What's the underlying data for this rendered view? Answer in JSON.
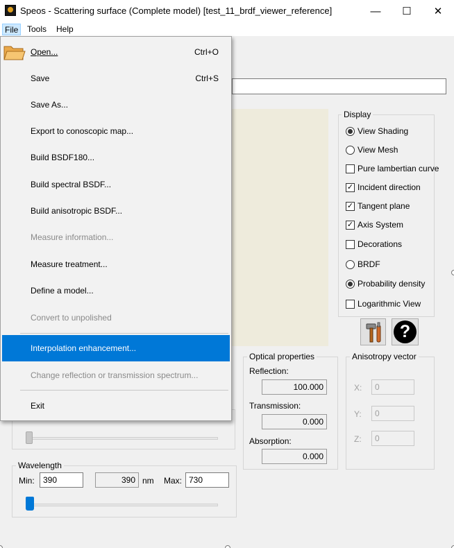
{
  "window": {
    "title": "Speos - Scattering surface (Complete model) [test_11_brdf_viewer_reference]",
    "minimize": "—",
    "maximize": "☐",
    "close": "✕"
  },
  "menubar": {
    "file": "File",
    "tools": "Tools",
    "help": "Help"
  },
  "file_menu": {
    "items": [
      {
        "label": "Open...",
        "shortcut": "Ctrl+O",
        "enabled": true
      },
      {
        "label": "Save",
        "shortcut": "Ctrl+S",
        "enabled": true
      },
      {
        "label": "Save As...",
        "shortcut": "",
        "enabled": true
      },
      {
        "label": "Export to conoscopic map...",
        "shortcut": "",
        "enabled": true
      },
      {
        "label": "Build BSDF180...",
        "shortcut": "",
        "enabled": true
      },
      {
        "label": "Build spectral BSDF...",
        "shortcut": "",
        "enabled": true
      },
      {
        "label": "Build anisotropic BSDF...",
        "shortcut": "",
        "enabled": true
      },
      {
        "label": "Measure information...",
        "shortcut": "",
        "enabled": false
      },
      {
        "label": "Measure treatment...",
        "shortcut": "",
        "enabled": true
      },
      {
        "label": "Define a model...",
        "shortcut": "",
        "enabled": true
      },
      {
        "label": "Convert to unpolished",
        "shortcut": "",
        "enabled": false
      },
      {
        "label": "Interpolation enhancement...",
        "shortcut": "",
        "enabled": true,
        "highlighted": true
      },
      {
        "label": "Change reflection or transmission spectrum...",
        "shortcut": "",
        "enabled": false
      },
      {
        "label": "Exit",
        "shortcut": "",
        "enabled": true
      }
    ]
  },
  "display": {
    "title": "Display",
    "view_shading": "View Shading",
    "view_mesh": "View Mesh",
    "pure_lambertian": "Pure lambertian curve",
    "incident_direction": "Incident direction",
    "tangent_plane": "Tangent plane",
    "axis_system": "Axis System",
    "decorations": "Decorations",
    "brdf": "BRDF",
    "probability_density": "Probability density",
    "logarithmic_view": "Logarithmic View"
  },
  "optical": {
    "title": "Optical properties",
    "reflection_label": "Reflection:",
    "reflection": "100.000",
    "transmission_label": "Transmission:",
    "transmission": "0.000",
    "absorption_label": "Absorption:",
    "absorption": "0.000"
  },
  "anisotropy": {
    "title": "Anisotropy vector",
    "x_label": "X:",
    "x": "0",
    "y_label": "Y:",
    "y": "0",
    "z_label": "Z:",
    "z": "0"
  },
  "wavelength": {
    "title": "Wavelength",
    "min_label": "Min:",
    "min": "390",
    "current": "390",
    "unit": "nm",
    "max_label": "Max:",
    "max": "730",
    "slider_position": 0.0
  },
  "icons": {
    "app": "speos-app-icon",
    "open": "folder-open-icon",
    "tools": "tools-icon",
    "help": "help-icon"
  }
}
